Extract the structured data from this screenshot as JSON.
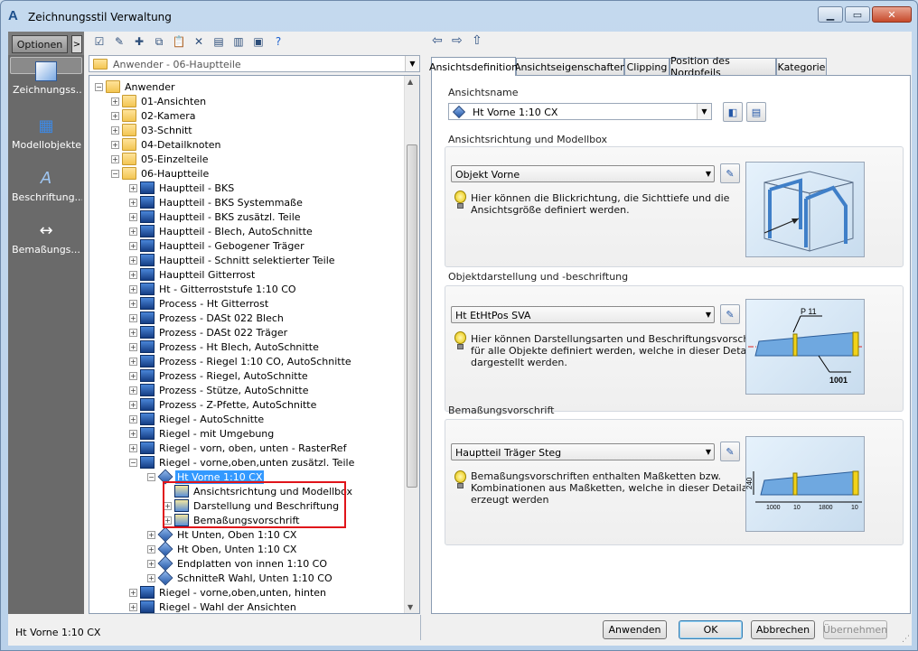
{
  "window": {
    "title": "Zeichnungsstil Verwaltung",
    "app_icon": "A"
  },
  "leftbar": {
    "options_label": "Optionen",
    "items": [
      {
        "label": "Zeichnungss...",
        "icon": "drawing-style-icon"
      },
      {
        "label": "Modellobjekte",
        "icon": "model-objects-icon"
      },
      {
        "label": "Beschriftung...",
        "icon": "labeling-icon"
      },
      {
        "label": "Bemaßungs...",
        "icon": "dimension-icon"
      }
    ]
  },
  "tree_combo": {
    "value": "Anwender - 06-Hauptteile"
  },
  "tree": [
    {
      "label": "Anwender",
      "level": 0,
      "icon": "folder",
      "exp": "-"
    },
    {
      "label": "01-Ansichten",
      "level": 1,
      "icon": "folder",
      "exp": "+"
    },
    {
      "label": "02-Kamera",
      "level": 1,
      "icon": "folder",
      "exp": "+"
    },
    {
      "label": "03-Schnitt",
      "level": 1,
      "icon": "folder",
      "exp": "+"
    },
    {
      "label": "04-Detailknoten",
      "level": 1,
      "icon": "folder",
      "exp": "+"
    },
    {
      "label": "05-Einzelteile",
      "level": 1,
      "icon": "folder",
      "exp": "+"
    },
    {
      "label": "06-Hauptteile",
      "level": 1,
      "icon": "folder",
      "exp": "-"
    },
    {
      "label": "Hauptteil - BKS",
      "level": 2,
      "icon": "part",
      "exp": "+"
    },
    {
      "label": "Hauptteil - BKS Systemmaße",
      "level": 2,
      "icon": "part",
      "exp": "+"
    },
    {
      "label": "Hauptteil - BKS zusätzl. Teile",
      "level": 2,
      "icon": "part",
      "exp": "+"
    },
    {
      "label": "Hauptteil - Blech, AutoSchnitte",
      "level": 2,
      "icon": "part",
      "exp": "+"
    },
    {
      "label": "Hauptteil - Gebogener Träger",
      "level": 2,
      "icon": "part",
      "exp": "+"
    },
    {
      "label": "Hauptteil - Schnitt selektierter Teile",
      "level": 2,
      "icon": "part",
      "exp": "+"
    },
    {
      "label": "Hauptteil Gitterrost",
      "level": 2,
      "icon": "part",
      "exp": "+"
    },
    {
      "label": "Ht - Gitterroststufe 1:10 CO",
      "level": 2,
      "icon": "part",
      "exp": "+"
    },
    {
      "label": "Process - Ht Gitterrost",
      "level": 2,
      "icon": "part",
      "exp": "+"
    },
    {
      "label": "Prozess - DASt 022 Blech",
      "level": 2,
      "icon": "part",
      "exp": "+"
    },
    {
      "label": "Prozess - DASt 022 Träger",
      "level": 2,
      "icon": "part",
      "exp": "+"
    },
    {
      "label": "Prozess - Ht Blech, AutoSchnitte",
      "level": 2,
      "icon": "part",
      "exp": "+"
    },
    {
      "label": "Prozess - Riegel 1:10 CO, AutoSchnitte",
      "level": 2,
      "icon": "part",
      "exp": "+"
    },
    {
      "label": "Prozess - Riegel, AutoSchnitte",
      "level": 2,
      "icon": "part",
      "exp": "+"
    },
    {
      "label": "Prozess - Stütze, AutoSchnitte",
      "level": 2,
      "icon": "part",
      "exp": "+"
    },
    {
      "label": "Prozess - Z-Pfette, AutoSchnitte",
      "level": 2,
      "icon": "part",
      "exp": "+"
    },
    {
      "label": "Riegel - AutoSchnitte",
      "level": 2,
      "icon": "part",
      "exp": "+"
    },
    {
      "label": "Riegel - mit Umgebung",
      "level": 2,
      "icon": "part",
      "exp": "+"
    },
    {
      "label": "Riegel - vorn, oben, unten - RasterRef",
      "level": 2,
      "icon": "part",
      "exp": "+"
    },
    {
      "label": "Riegel - vorne,oben,unten zusätzl. Teile",
      "level": 2,
      "icon": "part",
      "exp": "-"
    },
    {
      "label": "Ht Vorne 1:10 CX",
      "level": 3,
      "icon": "view",
      "exp": "-",
      "selected": true
    },
    {
      "label": "Ansichtsrichtung und Modellbox",
      "level": 4,
      "icon": "sub",
      "exp": ""
    },
    {
      "label": "Darstellung und Beschriftung",
      "level": 4,
      "icon": "sub",
      "exp": "+"
    },
    {
      "label": "Bemaßungsvorschrift",
      "level": 4,
      "icon": "sub",
      "exp": "+"
    },
    {
      "label": "Ht Unten, Oben 1:10 CX",
      "level": 3,
      "icon": "view",
      "exp": "+"
    },
    {
      "label": "Ht Oben, Unten 1:10 CX",
      "level": 3,
      "icon": "view",
      "exp": "+"
    },
    {
      "label": "Endplatten von innen 1:10 CO",
      "level": 3,
      "icon": "view",
      "exp": "+"
    },
    {
      "label": "SchnitteR Wahl, Unten 1:10 CO",
      "level": 3,
      "icon": "view",
      "exp": "+"
    },
    {
      "label": "Riegel - vorne,oben,unten, hinten",
      "level": 2,
      "icon": "part",
      "exp": "+"
    },
    {
      "label": "Riegel - Wahl der Ansichten",
      "level": 2,
      "icon": "part",
      "exp": "+"
    }
  ],
  "tabs": [
    "Ansichtsdefinition",
    "Ansichtseigenschaften",
    "Clipping",
    "Position des Nordpfeils",
    "Kategorie"
  ],
  "view": {
    "name_label": "Ansichtsname",
    "name_value": "Ht Vorne 1:10 CX"
  },
  "groups": {
    "direction": {
      "title": "Ansichtsrichtung und Modellbox",
      "value": "Objekt Vorne",
      "desc": [
        "Hier können die Blickrichtung, die Sichttiefe und die",
        "Ansichtsgröße definiert werden."
      ]
    },
    "display": {
      "title": "Objektdarstellung und -beschriftung",
      "value": "Ht EtHtPos SVA",
      "desc": [
        "Hier können Darstellungsarten und Beschriftungsvorschriften",
        "für alle Objekte definiert werden, welche in dieser Detailansicht",
        "dargestellt werden."
      ],
      "preview_labels": [
        "P 11",
        "1001"
      ]
    },
    "dimension": {
      "title": "Bemaßungsvorschrift",
      "value": "Hauptteil Träger Steg",
      "desc": [
        "Bemaßungsvorschriften enthalten Maßketten bzw.",
        "Kombinationen aus Maßketten, welche in dieser Detailansicht",
        "erzeugt werden"
      ],
      "preview_labels": [
        "240",
        "1000",
        "10",
        "1800",
        "10"
      ]
    }
  },
  "status": {
    "text": "Ht Vorne 1:10 CX"
  },
  "buttons": {
    "apply": "Anwenden",
    "ok": "OK",
    "cancel": "Abbrechen",
    "accept": "Übernehmen"
  }
}
